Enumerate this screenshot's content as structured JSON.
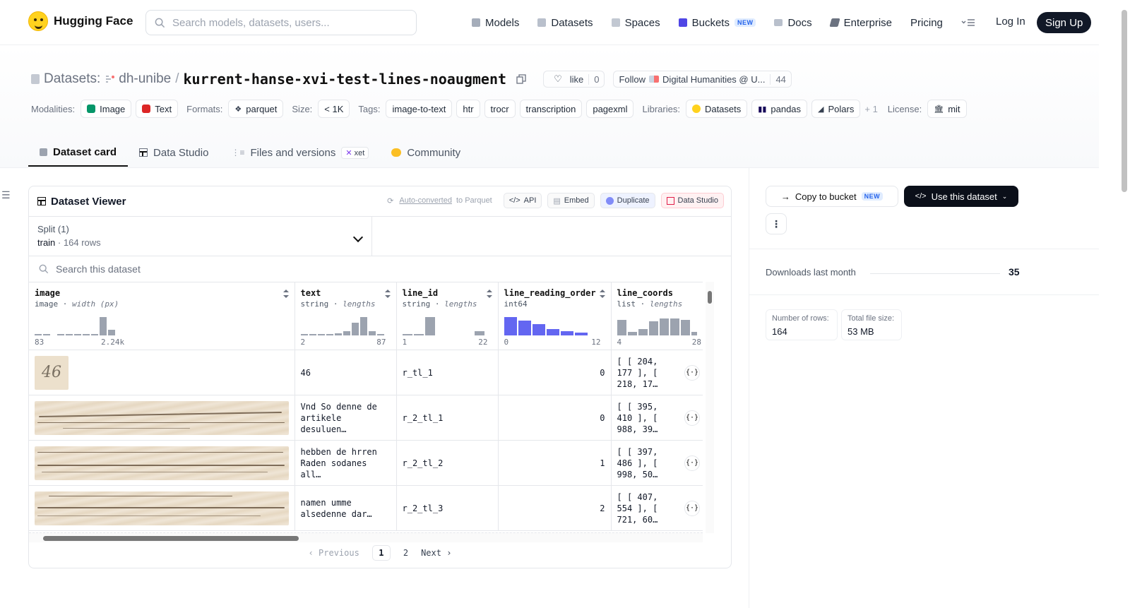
{
  "nav": {
    "brand": "Hugging Face",
    "search_placeholder": "Search models, datasets, users...",
    "items": [
      {
        "label": "Models"
      },
      {
        "label": "Datasets"
      },
      {
        "label": "Spaces"
      },
      {
        "label": "Buckets",
        "badge": "NEW"
      },
      {
        "label": "Docs"
      },
      {
        "label": "Enterprise"
      },
      {
        "label": "Pricing"
      }
    ],
    "login": "Log In",
    "signup": "Sign Up"
  },
  "header": {
    "prefix": "Datasets:",
    "org": "dh-unibe",
    "name": "kurrent-hanse-xvi-test-lines-noaugment",
    "like_label": "like",
    "like_count": "0",
    "follow_label": "Follow",
    "follow_org": "Digital Humanities @ U...",
    "follow_count": "44",
    "modalities_label": "Modalities:",
    "modalities": [
      "Image",
      "Text"
    ],
    "formats_label": "Formats:",
    "format": "parquet",
    "size_label": "Size:",
    "size": "< 1K",
    "tags_label": "Tags:",
    "tags": [
      "image-to-text",
      "htr",
      "trocr",
      "transcription",
      "pagexml"
    ],
    "libraries_label": "Libraries:",
    "libraries": [
      "Datasets",
      "pandas",
      "Polars"
    ],
    "libraries_more": "+ 1",
    "license_label": "License:",
    "license": "mit"
  },
  "tabs": [
    {
      "label": "Dataset card"
    },
    {
      "label": "Data Studio"
    },
    {
      "label": "Files and versions",
      "badge": "xet"
    },
    {
      "label": "Community"
    }
  ],
  "viewer": {
    "title": "Dataset Viewer",
    "auto_link": "Auto-converted",
    "auto_rest": "to Parquet",
    "api": "API",
    "embed": "Embed",
    "duplicate": "Duplicate",
    "data_studio": "Data Studio",
    "split_label": "Split (1)",
    "split_name": "train",
    "split_rows": "164 rows",
    "search_placeholder": "Search this dataset",
    "columns": [
      {
        "name": "image",
        "type": "image",
        "sub": "width (px)",
        "min": "83",
        "mid": "2.24k",
        "max": ""
      },
      {
        "name": "text",
        "type": "string",
        "sub": "lengths",
        "min": "2",
        "max": "87"
      },
      {
        "name": "line_id",
        "type": "string",
        "sub": "lengths",
        "min": "1",
        "max": "22"
      },
      {
        "name": "line_reading_order",
        "type": "int64",
        "sub": "",
        "min": "0",
        "max": "12"
      },
      {
        "name": "line_coords",
        "type": "list",
        "sub": "lengths",
        "min": "4",
        "max": "28"
      }
    ],
    "rows": [
      {
        "text": "46",
        "line_id": "r_tl_1",
        "order": "0",
        "coords": "[ [ 204, 177 ], [ 218, 17…"
      },
      {
        "text": "Vnd So denne de artikele desuluen…",
        "line_id": "r_2_tl_1",
        "order": "0",
        "coords": "[ [ 395, 410 ], [ 988, 39…"
      },
      {
        "text": "hebben de hrren Raden sodanes all…",
        "line_id": "r_2_tl_2",
        "order": "1",
        "coords": "[ [ 397, 486 ], [ 998, 50…"
      },
      {
        "text": "namen umme alsedenne dar…",
        "line_id": "r_2_tl_3",
        "order": "2",
        "coords": "[ [ 407, 554 ], [ 721, 60…"
      }
    ],
    "json_icon": "{·}",
    "image_thumb_text": "46",
    "prev": "Previous",
    "pages": [
      "1",
      "2"
    ],
    "next": "Next"
  },
  "sidebar": {
    "copy_bucket": "Copy to bucket",
    "copy_badge": "NEW",
    "use_dataset": "Use this dataset",
    "downloads_label": "Downloads last month",
    "downloads_value": "35",
    "rows_label": "Number of rows:",
    "rows_value": "164",
    "size_label": "Total file size:",
    "size_value": "53 MB"
  }
}
